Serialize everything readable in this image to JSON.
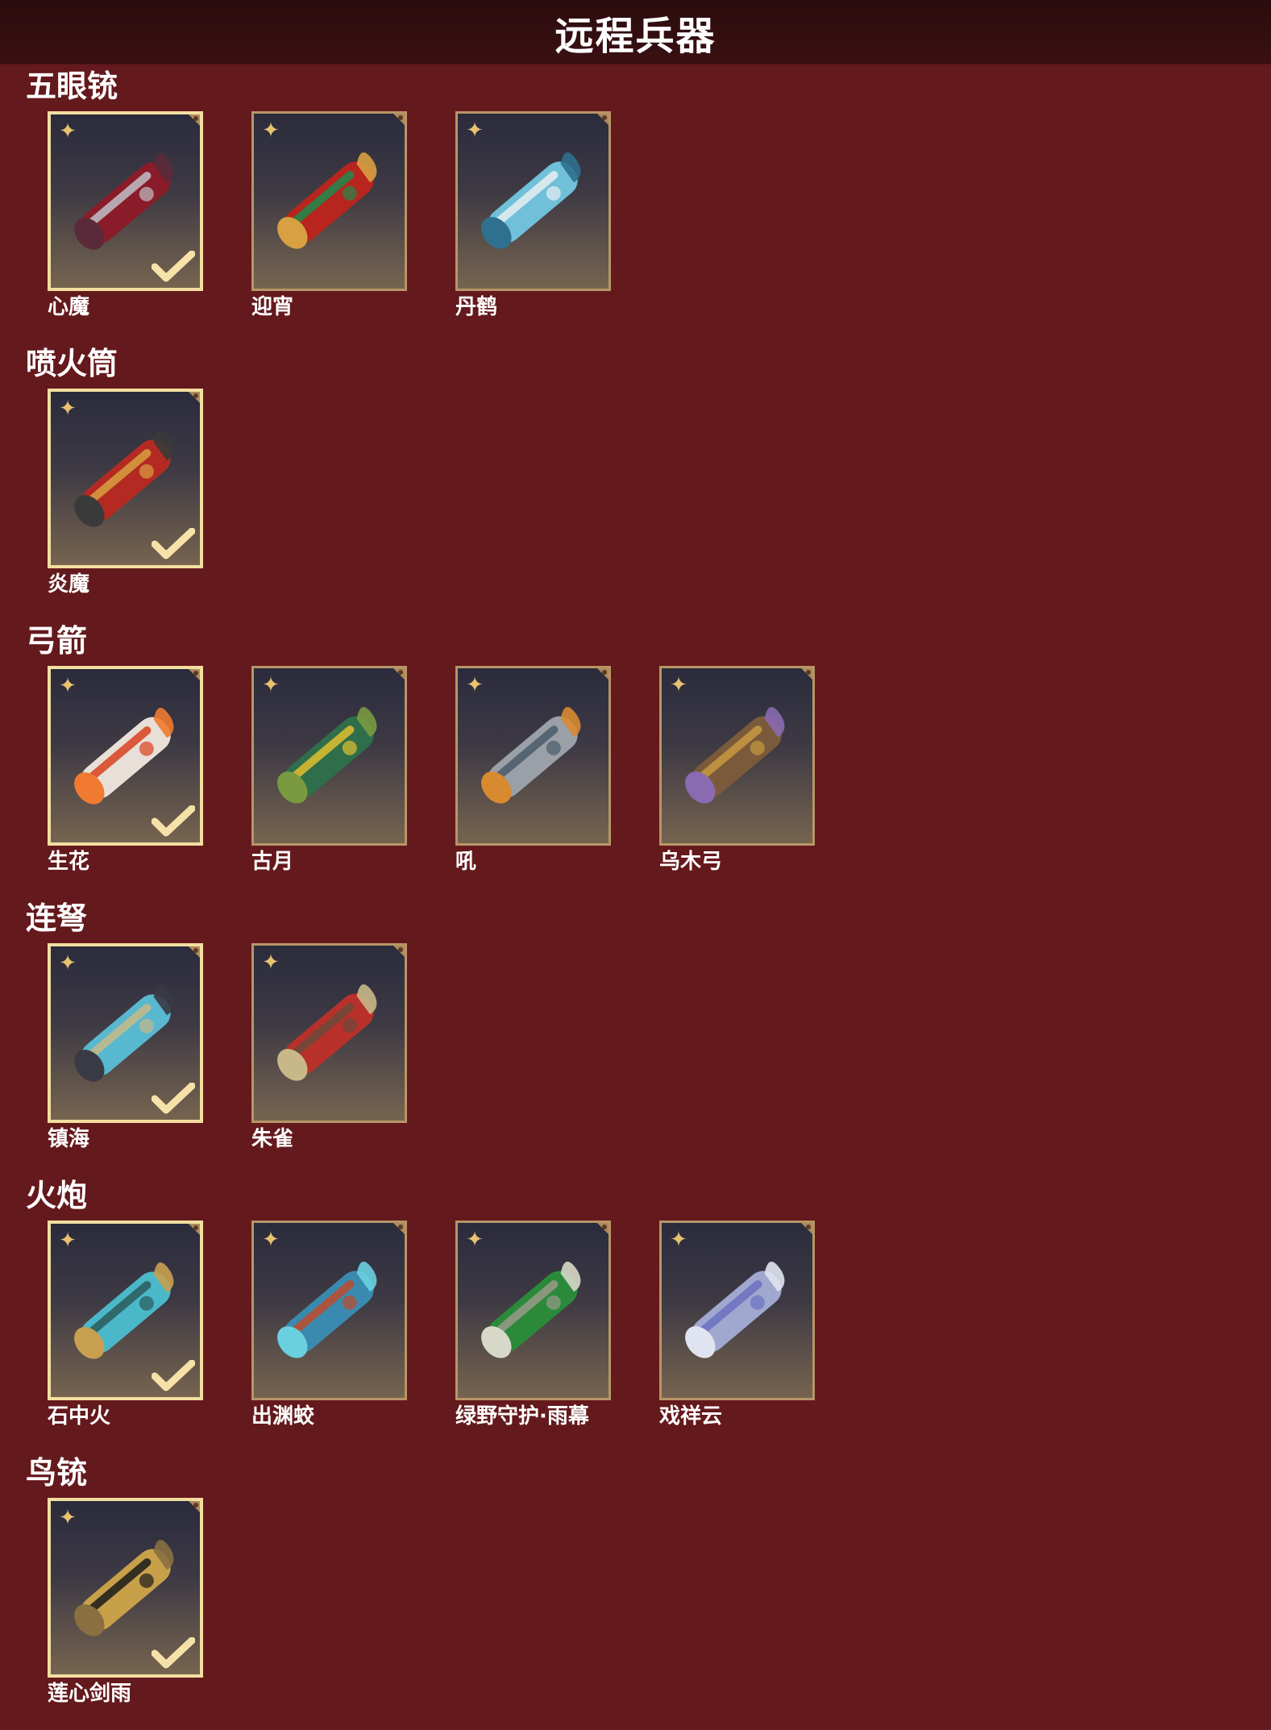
{
  "page": {
    "title": "远程兵器"
  },
  "colors": {
    "background": "#64191d",
    "header": "#2b0c0e",
    "frame": "#b89567",
    "frame_equipped": "#f3dea0",
    "star": "#e8c26f"
  },
  "icons": {
    "rarity": "four-point-star-icon",
    "equipped": "checkmark-icon"
  },
  "categories": [
    {
      "name": "五眼铳",
      "items": [
        {
          "name": "心魔",
          "equipped": true
        },
        {
          "name": "迎宵",
          "equipped": false
        },
        {
          "name": "丹鹤",
          "equipped": false
        }
      ]
    },
    {
      "name": "喷火筒",
      "items": [
        {
          "name": "炎魔",
          "equipped": true
        }
      ]
    },
    {
      "name": "弓箭",
      "items": [
        {
          "name": "生花",
          "equipped": true
        },
        {
          "name": "古月",
          "equipped": false
        },
        {
          "name": "吼",
          "equipped": false
        },
        {
          "name": "乌木弓",
          "equipped": false
        }
      ]
    },
    {
      "name": "连弩",
      "items": [
        {
          "name": "镇海",
          "equipped": true
        },
        {
          "name": "朱雀",
          "equipped": false
        }
      ]
    },
    {
      "name": "火炮",
      "items": [
        {
          "name": "石中火",
          "equipped": true
        },
        {
          "name": "出渊蛟",
          "equipped": false
        },
        {
          "name": "绿野守护·雨幕",
          "equipped": false
        },
        {
          "name": "戏祥云",
          "equipped": false
        }
      ]
    },
    {
      "name": "鸟铳",
      "items": [
        {
          "name": "莲心剑雨",
          "equipped": true
        }
      ]
    }
  ]
}
